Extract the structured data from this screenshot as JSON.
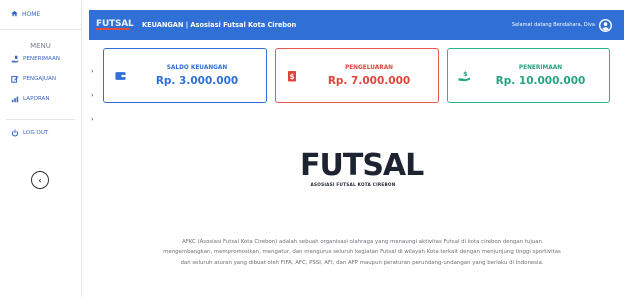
{
  "sidebar": {
    "home_label": "HOME",
    "menu_title": "MENU",
    "items": [
      {
        "label": "PENERIMAAN",
        "icon": "money-hand-icon"
      },
      {
        "label": "PENGAJUAN",
        "icon": "edit-icon"
      },
      {
        "label": "LAPORAN",
        "icon": "chart-icon"
      }
    ],
    "logout_label": "LOG OUT",
    "collapse_symbol": "‹"
  },
  "header": {
    "logo_text": "FUTSAL",
    "title": "KEUANGAN | Asosiasi Futsal Kota Cirebon",
    "greeting": "Selamat datang Bendahara, Diva"
  },
  "cards": {
    "saldo": {
      "title": "SALDO KEUANGAN",
      "value": "Rp. 3.000.000",
      "color": "#2f6fd6",
      "icon": "wallet-icon"
    },
    "pengeluaran": {
      "title": "PENGELUARAN",
      "value": "Rp. 7.000.000",
      "color": "#e0453b",
      "icon": "money-bag-icon"
    },
    "penerimaan": {
      "title": "PENERIMAAN",
      "value": "Rp. 10.000.000",
      "color": "#27a47f",
      "icon": "hand-coin-icon"
    }
  },
  "brand": {
    "logo_word": "FUTSAL",
    "logo_sub": "ASOSIASI FUTSAL KOTA CIREBON"
  },
  "description": {
    "line1": "AFKC (Asosiasi Futsal Kota Cirebon) adalah sebuah organisasi olahraga yang menaungi aktivitas Futsal di kota cirebon dengan tujuan",
    "line2": "mengembangkan, mempromosikan, mengatur, dan mengurus seluruh kegiatan Futsal di wilayah Kota terkait dengan menjunjung tinggi sportivitas",
    "line3": "dan seluruh aturan yang dibuat oleh FIFA, AFC, PSSI, AFI, dan AFP maupun peraturan perundang-undangan yang berlaku di Indonesia."
  },
  "arrows": "›"
}
